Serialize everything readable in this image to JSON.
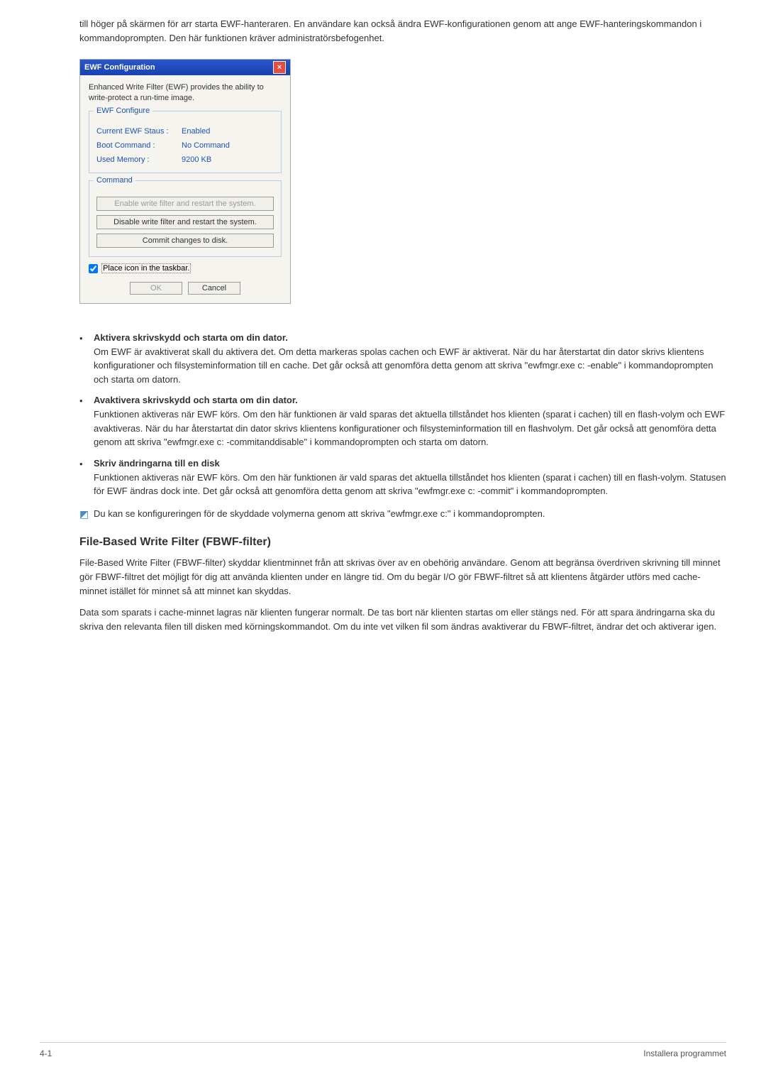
{
  "intro": "till höger på skärmen för arr starta EWF-hanteraren. En användare kan också ändra EWF-konfigurationen genom att ange EWF-hanteringskommandon i kommandoprompten. Den här funktionen kräver administratörsbefogenhet.",
  "dialog": {
    "title": "EWF Configuration",
    "close": "×",
    "desc": "Enhanced Write Filter (EWF) provides the ability to write-protect a run-time image.",
    "configure_legend": "EWF Configure",
    "status_label": "Current EWF Staus :",
    "status_value": "Enabled",
    "bootcmd_label": "Boot Command :",
    "bootcmd_value": "No Command",
    "usedmem_label": "Used Memory :",
    "usedmem_value": "9200 KB",
    "command_legend": "Command",
    "btn_enable": "Enable write filter and restart the system.",
    "btn_disable": "Disable write filter and restart the system.",
    "btn_commit": "Commit changes to disk.",
    "chk_label": "Place icon in the taskbar.",
    "ok": "OK",
    "cancel": "Cancel"
  },
  "bullets": [
    {
      "title": "Aktivera skrivskydd och starta om din dator.",
      "body": "Om EWF är avaktiverat skall du aktivera det. Om detta markeras spolas cachen och EWF är aktiverat. När du har återstartat din dator skrivs klientens konfigurationer och filsysteminformation till en cache. Det går också att genomföra detta genom att skriva \"ewfmgr.exe c: -enable\" i kommandoprompten och starta om datorn."
    },
    {
      "title": "Avaktivera skrivskydd och starta om din dator.",
      "body": "Funktionen aktiveras när EWF körs. Om den här funktionen är vald sparas det aktuella tillståndet hos klienten (sparat i cachen) till en flash-volym och EWF avaktiveras. När du har återstartat din dator skrivs klientens konfigurationer och filsysteminformation till en flashvolym. Det går också att genomföra detta genom att skriva \"ewfmgr.exe c: -commitanddisable\" i kommandoprompten och starta om datorn."
    },
    {
      "title": "Skriv ändringarna till en disk",
      "body": "Funktionen aktiveras när EWF körs. Om den här funktionen är vald sparas det aktuella tillståndet hos klienten (sparat i cachen) till en flash-volym. Statusen för EWF ändras dock inte. Det går också att genomföra detta genom att skriva \"ewfmgr.exe c: -commit\" i kommandoprompten."
    }
  ],
  "note": "Du kan se konfigureringen för de skyddade volymerna genom att skriva \"ewfmgr.exe c:\" i kommandoprompten.",
  "h2": "File-Based Write Filter (FBWF-filter)",
  "p1": "File-Based Write Filter (FBWF-filter) skyddar klientminnet från att skrivas över av en obehörig användare. Genom att begränsa överdriven skrivning till minnet gör FBWF-filtret det möjligt för dig att använda klienten under en längre tid. Om du begär I/O gör FBWF-filtret så att klientens åtgärder utförs med cache-minnet istället för minnet så att minnet kan skyddas.",
  "p2": "Data som sparats i cache-minnet lagras när klienten fungerar normalt. De tas bort när klienten startas om eller stängs ned. För att spara ändringarna ska du skriva den relevanta filen till disken med körningskommandot. Om du inte vet vilken fil som ändras avaktiverar du FBWF-filtret, ändrar det och aktiverar igen.",
  "footer": {
    "left": "4-1",
    "right": "Installera programmet"
  }
}
